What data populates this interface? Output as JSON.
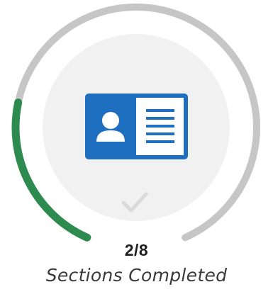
{
  "progress": {
    "completed": 2,
    "total": 8,
    "count_text": "2/8",
    "caption": "Sections Completed",
    "fraction": 0.25
  },
  "icons": {
    "center": "id-card-icon",
    "status": "checkmark-icon"
  },
  "colors": {
    "progress": "#2e8b4f",
    "track": "#c6c6c6",
    "inner_circle": "#f1f1f1",
    "card_blue": "#1f6fc0",
    "checkmark": "#d9d9d9"
  }
}
